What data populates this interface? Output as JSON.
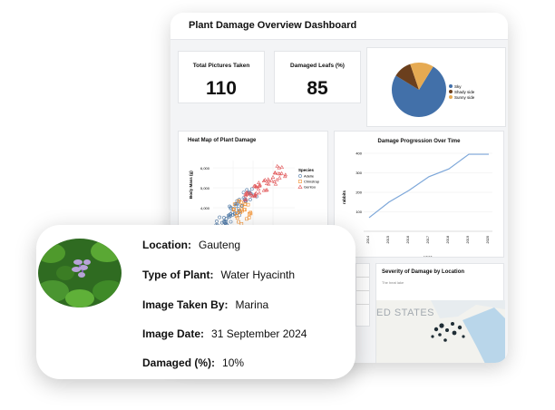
{
  "dashboard": {
    "title": "Plant Damage Overview Dashboard",
    "stats": [
      {
        "label": "Total Pictures Taken",
        "value": "110"
      },
      {
        "label": "Damaged Leafs (%)",
        "value": "85"
      }
    ],
    "pie": {
      "legend": [
        "Sky",
        "Shady side",
        "Sunny side"
      ],
      "colors": [
        "#4270a9",
        "#6b3f1d",
        "#e6aa52"
      ],
      "values": [
        0.75,
        0.11,
        0.14
      ]
    },
    "heatmap": {
      "title": "Heat Map of Plant Damage",
      "ylabel": "Body Mass (g)",
      "yticks": [
        "6,000",
        "5,000",
        "4,000"
      ],
      "legend_title": "Species",
      "legend": [
        "Adelie",
        "Chinstrap",
        "Gentoo"
      ],
      "colors": [
        "#4e79a7",
        "#f28e2b",
        "#e15759"
      ]
    },
    "line": {
      "title": "Damage Progression Over Time",
      "ylabel": "rabbits",
      "xlabel": "year",
      "yticks": [
        "400",
        "300",
        "200",
        "100"
      ],
      "xticks": [
        "2014",
        "2015",
        "2016",
        "2017",
        "2018",
        "2019",
        "2020"
      ]
    },
    "map": {
      "title": "Severity of Damage by Location",
      "subtitle": "The heat lake",
      "label": "ED STATES"
    }
  },
  "chart_data": {
    "type": "line",
    "title": "Damage Progression Over Time",
    "xlabel": "year",
    "ylabel": "rabbits",
    "x": [
      "2014",
      "2015",
      "2016",
      "2017",
      "2018",
      "2019",
      "2020"
    ],
    "values": [
      70,
      150,
      210,
      280,
      320,
      395,
      395
    ],
    "ylim": [
      0,
      400
    ]
  },
  "info": {
    "rows": [
      {
        "key": "Location:",
        "value": "Gauteng"
      },
      {
        "key": "Type of Plant:",
        "value": "Water Hyacinth"
      },
      {
        "key": "Image Taken By:",
        "value": "Marina"
      },
      {
        "key": "Image Date:",
        "value": "31 September 2024"
      },
      {
        "key": "Damaged (%):",
        "value": "10%"
      }
    ]
  }
}
